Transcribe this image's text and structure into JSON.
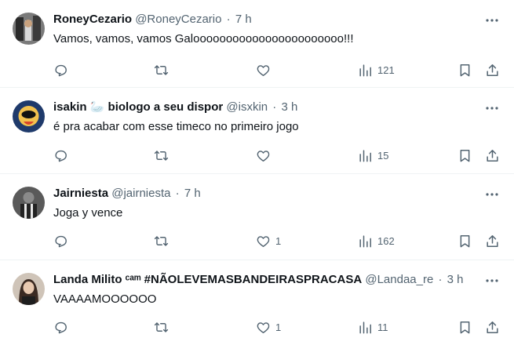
{
  "tweets": [
    {
      "name": "RoneyCezario",
      "handle": "@RoneyCezario",
      "separator": "·",
      "time": "7 h",
      "text": "Vamos, vamos, vamos Galooooooooooooooooooooooo!!!",
      "likes": "",
      "views": "121",
      "avatar_color": "#6b6b6b"
    },
    {
      "name": "isakin 🦢 biologo a seu dispor",
      "handle": "@isxkin",
      "separator": "·",
      "time": "3 h",
      "text": "é pra acabar com esse timeco no primeiro jogo",
      "likes": "",
      "views": "15",
      "avatar_color": "#1f3a6b"
    },
    {
      "name": "Jairniesta",
      "handle": "@jairniesta",
      "separator": "·",
      "time": "7 h",
      "text": "Joga y vence",
      "likes": "1",
      "views": "162",
      "avatar_color": "#4a4a4a"
    },
    {
      "name": "Landa Milito ᶜᵃᵐ #NÃOLEVEMASBANDEIRASPRACASA",
      "handle": "@Landaa_re",
      "separator": "·",
      "time": "3 h",
      "text": "VAAAAMOOOOOO",
      "likes": "1",
      "views": "11",
      "avatar_color": "#b8a89a"
    }
  ],
  "icons": {
    "reply": "reply-icon",
    "retweet": "retweet-icon",
    "like": "like-icon",
    "views": "views-icon",
    "bookmark": "bookmark-icon",
    "share": "share-icon",
    "more": "more-icon"
  }
}
